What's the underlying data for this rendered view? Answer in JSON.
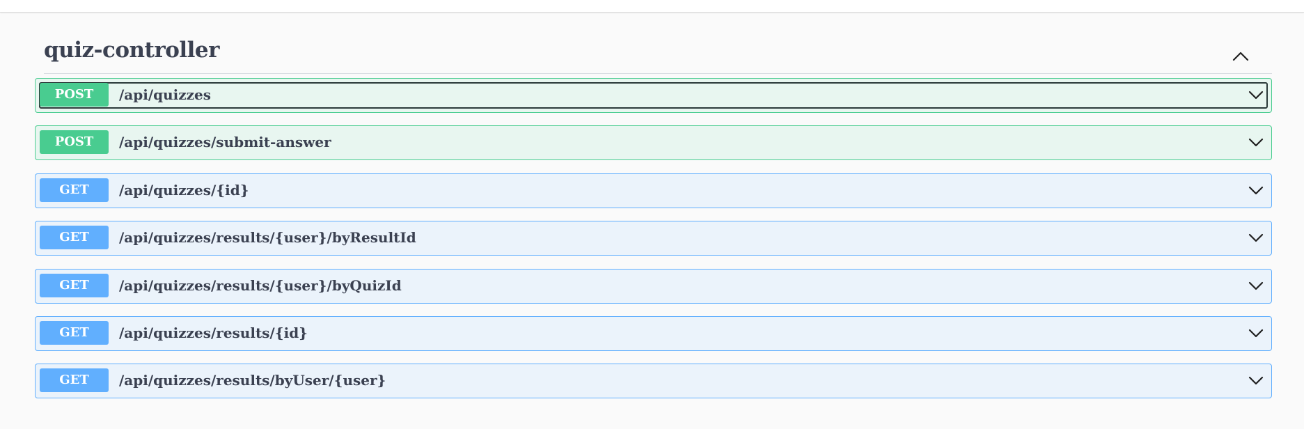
{
  "section": {
    "title": "quiz-controller",
    "toggle_icon": "chevron-up-icon"
  },
  "operations": [
    {
      "method": "POST",
      "path": "/api/quizzes",
      "focused": true
    },
    {
      "method": "POST",
      "path": "/api/quizzes/submit-answer",
      "focused": false
    },
    {
      "method": "GET",
      "path": "/api/quizzes/{id}",
      "focused": false
    },
    {
      "method": "GET",
      "path": "/api/quizzes/results/{user}/byResultId",
      "focused": false
    },
    {
      "method": "GET",
      "path": "/api/quizzes/results/{user}/byQuizId",
      "focused": false
    },
    {
      "method": "GET",
      "path": "/api/quizzes/results/{id}",
      "focused": false
    },
    {
      "method": "GET",
      "path": "/api/quizzes/results/byUser/{user}",
      "focused": false
    }
  ],
  "colors": {
    "post": "#49cc90",
    "get": "#61affe",
    "text": "#3b4151"
  },
  "icons": {
    "expand": "chevron-down-icon"
  }
}
